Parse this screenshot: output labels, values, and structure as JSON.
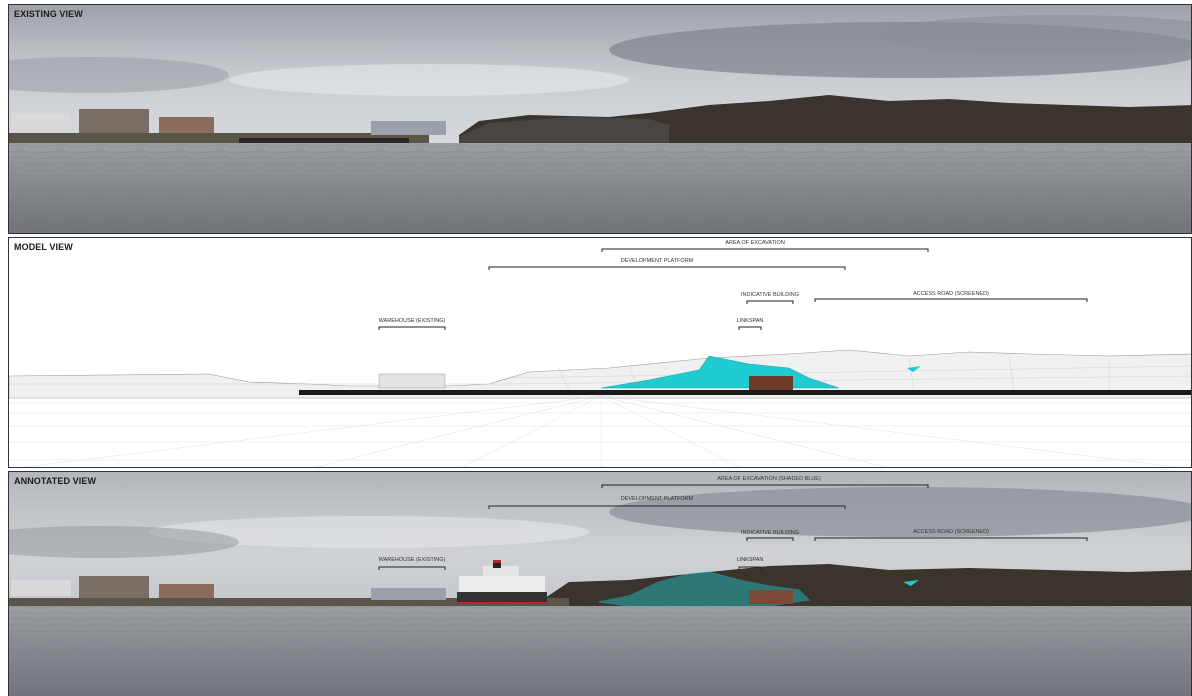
{
  "panels": {
    "existing": {
      "title": "EXISTING VIEW"
    },
    "model": {
      "title": "MODEL VIEW",
      "labels": {
        "excavation": "AREA OF EXCAVATION",
        "platform": "DEVELOPMENT PLATFORM",
        "building": "INDICATIVE BUILDING",
        "road": "ACCESS ROAD (SCREENED)",
        "warehouse": "WAREHOUSE (EXISTING)",
        "linkspan": "LINKSPAN"
      }
    },
    "annotated": {
      "title": "ANNOTATED VIEW",
      "labels": {
        "excavation": "AREA OF EXCAVATION (SHADED BLUE)",
        "platform": "DEVELOPMENT PLATFORM",
        "building": "INDICATIVE BUILDING",
        "road": "ACCESS ROAD (SCREENED)",
        "warehouse": "WAREHOUSE (EXISTING)",
        "linkspan": "LINKSPAN"
      }
    }
  },
  "colors": {
    "sky": "#c9ccd1",
    "cloud_dark": "#7d8288",
    "water": "#8a8e92",
    "hills": "#3a342c",
    "excavation": "#1ecbd0",
    "mesh": "#bdbdbd"
  }
}
